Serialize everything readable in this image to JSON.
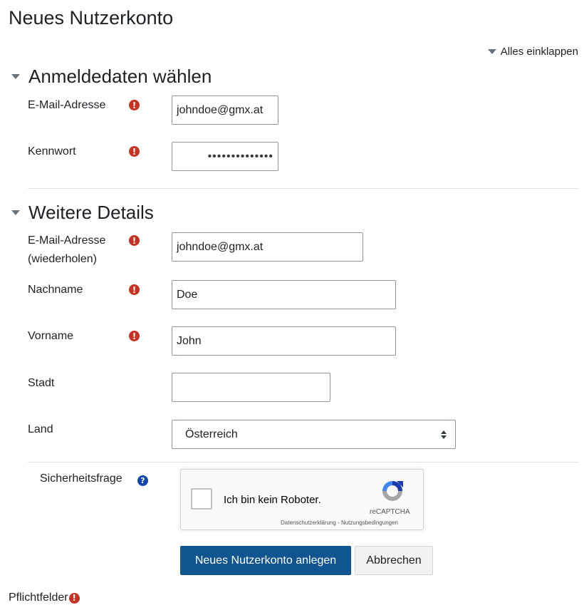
{
  "page": {
    "title": "Neues Nutzerkonto"
  },
  "collapse_all": {
    "label": "Alles einklappen"
  },
  "sections": {
    "login": {
      "title": "Anmeldedaten wählen",
      "email": {
        "label": "E-Mail-Adresse",
        "value": "johndoe@gmx.at"
      },
      "password": {
        "label": "Kennwort",
        "value": "••••••••••••••"
      }
    },
    "details": {
      "title": "Weitere Details",
      "email_repeat": {
        "label_line1": "E-Mail-Adresse",
        "label_line2": "(wiederholen)",
        "value": "johndoe@gmx.at"
      },
      "lastname": {
        "label": "Nachname",
        "value": "Doe"
      },
      "firstname": {
        "label": "Vorname",
        "value": "John"
      },
      "city": {
        "label": "Stadt",
        "value": ""
      },
      "country": {
        "label": "Land",
        "value": "Österreich"
      }
    }
  },
  "security": {
    "label": "Sicherheitsfrage",
    "captcha": {
      "checkbox_label": "Ich bin kein Roboter.",
      "brand": "reCAPTCHA",
      "privacy": "Datenschutzerklärung",
      "separator": " - ",
      "terms": "Nutzungsbedingungen"
    }
  },
  "buttons": {
    "submit": "Neues Nutzerkonto anlegen",
    "cancel": "Abbrechen"
  },
  "footer": {
    "required_label": "Pflichtfelder"
  },
  "icons": {
    "required": "!",
    "help": "?"
  },
  "colors": {
    "required": "#ca3120",
    "help": "#0f47ad",
    "primary_button": "#10558f"
  }
}
